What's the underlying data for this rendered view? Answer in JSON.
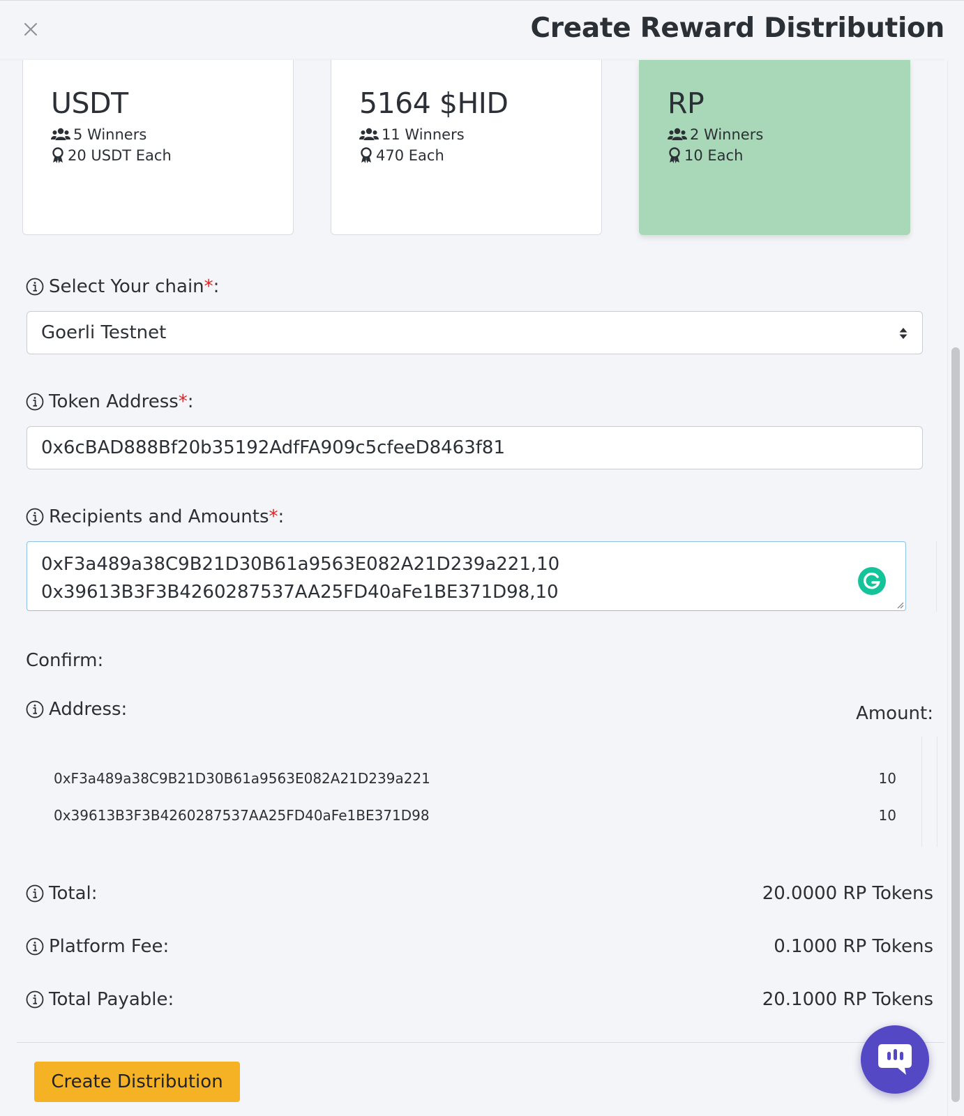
{
  "modal": {
    "title": "Create Reward Distribution"
  },
  "rewards": [
    {
      "title": "USDT",
      "winners": "5 Winners",
      "each": "20 USDT Each",
      "selected": false
    },
    {
      "title": "5164 $HID",
      "winners": "11 Winners",
      "each": "470 Each",
      "selected": false
    },
    {
      "title": "RP",
      "winners": "2 Winners",
      "each": "10 Each",
      "selected": true
    }
  ],
  "form": {
    "chain": {
      "label": "Select Your chain",
      "required": "*",
      "suffix": ":",
      "value": "Goerli Testnet"
    },
    "token": {
      "label": "Token Address",
      "required": "*",
      "suffix": ":",
      "value": "0x6cBAD888Bf20b35192AdfFA909c5cfeeD8463f81"
    },
    "recipients": {
      "label": "Recipients and Amounts",
      "required": "*",
      "suffix": ":",
      "lines": [
        "0xF3a489a38C9B21D30B61a9563E082A21D239a221,10",
        "0x39613B3F3B4260287537AA25FD40aFe1BE371D98,10"
      ]
    }
  },
  "confirm": {
    "label": "Confirm:",
    "address_header": "Address:",
    "amount_header": "Amount:",
    "rows": [
      {
        "address": "0xF3a489a38C9B21D30B61a9563E082A21D239a221",
        "amount": "10"
      },
      {
        "address": "0x39613B3F3B4260287537AA25FD40aFe1BE371D98",
        "amount": "10"
      }
    ]
  },
  "summary": {
    "total_label": "Total:",
    "total_value": "20.0000 RP Tokens",
    "fee_label": "Platform Fee:",
    "fee_value": "0.1000 RP Tokens",
    "payable_label": "Total Payable:",
    "payable_value": "20.1000 RP Tokens"
  },
  "actions": {
    "create_label": "Create Distribution"
  },
  "colors": {
    "selected_card": "#a9d8b8",
    "primary_button": "#f4b224",
    "required": "#e02424",
    "chat": "#5548c5",
    "grammarly": "#15c39a"
  },
  "icons": {
    "close": "close-icon",
    "winners": "users-icon",
    "each": "award-icon",
    "info": "info-icon",
    "select": "sort-arrows-icon",
    "grammarly": "grammarly-icon",
    "chat": "chat-icon"
  }
}
